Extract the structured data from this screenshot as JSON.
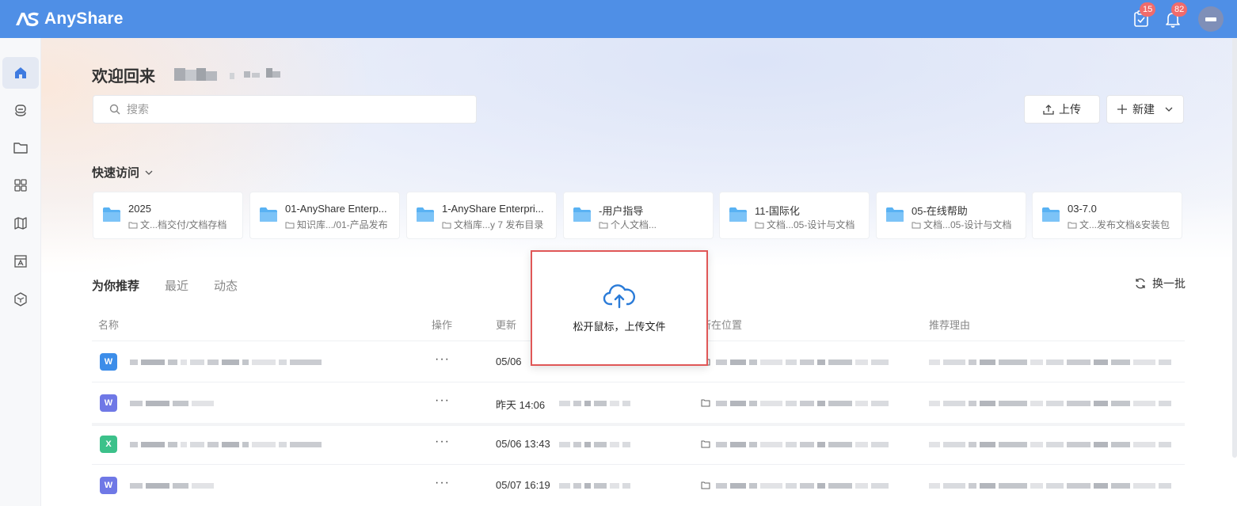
{
  "header": {
    "app_name": "AnyShare",
    "tasks_badge": "15",
    "notifications_badge": "82",
    "brand_color": "#4f8fe6"
  },
  "sidebar": {
    "items": [
      {
        "icon": "home-icon",
        "active": true
      },
      {
        "icon": "assistant-icon"
      },
      {
        "icon": "folder-icon"
      },
      {
        "icon": "apps-grid-icon"
      },
      {
        "icon": "map-icon"
      },
      {
        "icon": "template-icon"
      },
      {
        "icon": "cube-icon"
      }
    ]
  },
  "welcome": {
    "title": "欢迎回来"
  },
  "search": {
    "placeholder": "搜索"
  },
  "actions": {
    "upload_label": "上传",
    "new_label": "新建"
  },
  "quick_access": {
    "title": "快速访问",
    "cards": [
      {
        "title": "2025",
        "path": "文...档交付/文档存档"
      },
      {
        "title": "01-AnyShare Enterp...",
        "path": "知识库.../01-产品发布"
      },
      {
        "title": "1-AnyShare Enterpri...",
        "path": "文档库...y 7 发布目录"
      },
      {
        "title": "-用户指导",
        "path": "个人文档..."
      },
      {
        "title": "11-国际化",
        "path": "文档...05-设计与文档"
      },
      {
        "title": "05-在线帮助",
        "path": "文档...05-设计与文档"
      },
      {
        "title": "03-7.0",
        "path": "文...发布文档&安装包"
      }
    ]
  },
  "tabs": {
    "recommend": "为你推荐",
    "recent": "最近",
    "activity": "动态",
    "refresh": "换一批"
  },
  "table": {
    "headers": {
      "name": "名称",
      "actions": "操作",
      "updated": "更新",
      "location": "所在位置",
      "reason": "推荐理由"
    },
    "rows": [
      {
        "type": "word",
        "date": "05/06",
        "more": "···"
      },
      {
        "type": "wps",
        "date": "昨天 14:06",
        "more": "···"
      },
      {
        "type": "excel",
        "date": "05/06 13:43",
        "more": "···"
      },
      {
        "type": "wps",
        "date": "05/07 16:19",
        "more": "···"
      }
    ]
  },
  "drop_overlay": {
    "text": "松开鼠标，上传文件"
  }
}
